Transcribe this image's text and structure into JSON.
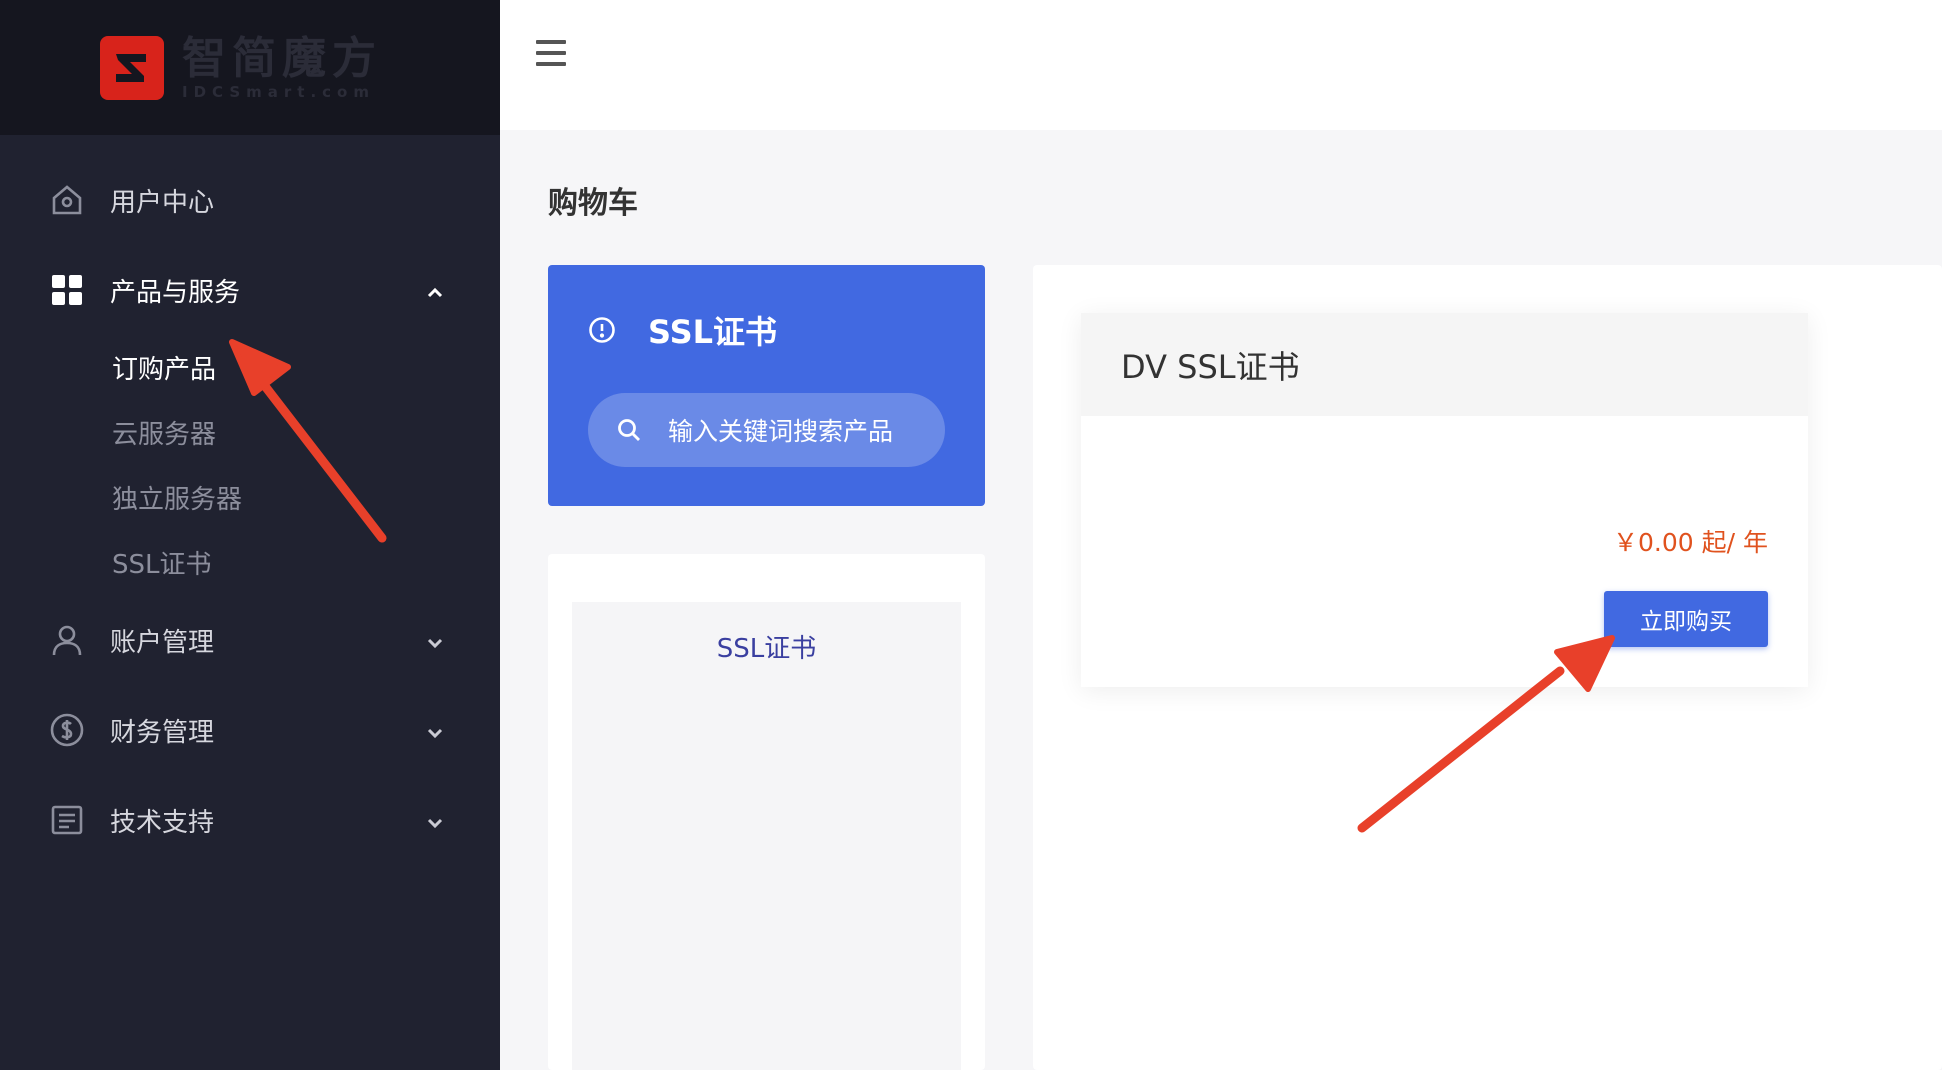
{
  "brand": {
    "name": "智简魔方",
    "sub": "IDCSmart.com"
  },
  "sidebar": {
    "items": [
      {
        "label": "用户中心",
        "icon": "home-icon"
      },
      {
        "label": "产品与服务",
        "icon": "grid-icon",
        "expanded": true
      },
      {
        "label": "账户管理",
        "icon": "user-icon"
      },
      {
        "label": "财务管理",
        "icon": "dollar-icon"
      },
      {
        "label": "技术支持",
        "icon": "document-icon"
      }
    ],
    "subitems": [
      {
        "label": "订购产品",
        "current": true
      },
      {
        "label": "云服务器"
      },
      {
        "label": "独立服务器"
      },
      {
        "label": "SSL证书"
      }
    ]
  },
  "page": {
    "title": "购物车"
  },
  "category": {
    "title": "SSL证书",
    "search_placeholder": "输入关键词搜索产品",
    "list": [
      "SSL证书"
    ]
  },
  "product": {
    "name": "DV SSL证书",
    "price": "￥0.00 起/ 年",
    "buy_label": "立即购买"
  },
  "colors": {
    "sidebar_bg": "#202230",
    "accent": "#4169e1",
    "price": "#e0521e",
    "annotation": "#e8402a"
  }
}
